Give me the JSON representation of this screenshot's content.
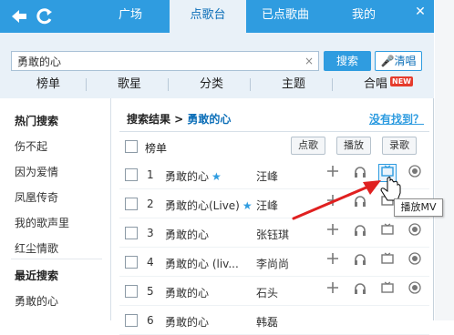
{
  "topbar": {
    "back_icon": "back-arrow-icon",
    "refresh_icon": "refresh-icon",
    "tabs": [
      "广场",
      "点歌台",
      "已点歌曲",
      "我的"
    ],
    "active_tab": "点歌台",
    "colors": {
      "accent": "#2f9ce0",
      "active_bg": "#e9f1f8"
    }
  },
  "search": {
    "value": "勇敢的心",
    "clear_glyph": "×",
    "search_button": "搜索",
    "qingchang_button": "清唱"
  },
  "categories": [
    "榜单",
    "歌星",
    "分类",
    "主题",
    "合唱"
  ],
  "new_badge": "NEW",
  "sidebar": {
    "hot_title": "热门搜索",
    "hot_items": [
      "伤不起",
      "因为爱情",
      "凤凰传奇",
      "我的歌声里",
      "红尘情歌"
    ],
    "recent_title": "最近搜索",
    "recent_items": [
      "勇敢的心"
    ]
  },
  "results": {
    "breadcrumb_prefix": "搜索结果 >",
    "keyword": "勇敢的心",
    "not_found": "没有找到？",
    "header_label": "榜单",
    "buttons": [
      "点歌",
      "播放",
      "录歌"
    ],
    "rows": [
      {
        "num": "1",
        "song": "勇敢的心",
        "star": true,
        "artist": "汪峰"
      },
      {
        "num": "2",
        "song": "勇敢的心(Live)",
        "star": true,
        "artist": "汪峰"
      },
      {
        "num": "3",
        "song": "勇敢的心",
        "star": false,
        "artist": "张钰琪"
      },
      {
        "num": "4",
        "song": "勇敢的心 (liv...",
        "star": false,
        "artist": "李尚尚"
      },
      {
        "num": "5",
        "song": "勇敢的心",
        "star": false,
        "artist": "石头"
      },
      {
        "num": "6",
        "song": "勇敢的心",
        "star": false,
        "artist": "韩磊"
      }
    ]
  },
  "tooltip": "播放MV",
  "annotation_color": "#e02020"
}
